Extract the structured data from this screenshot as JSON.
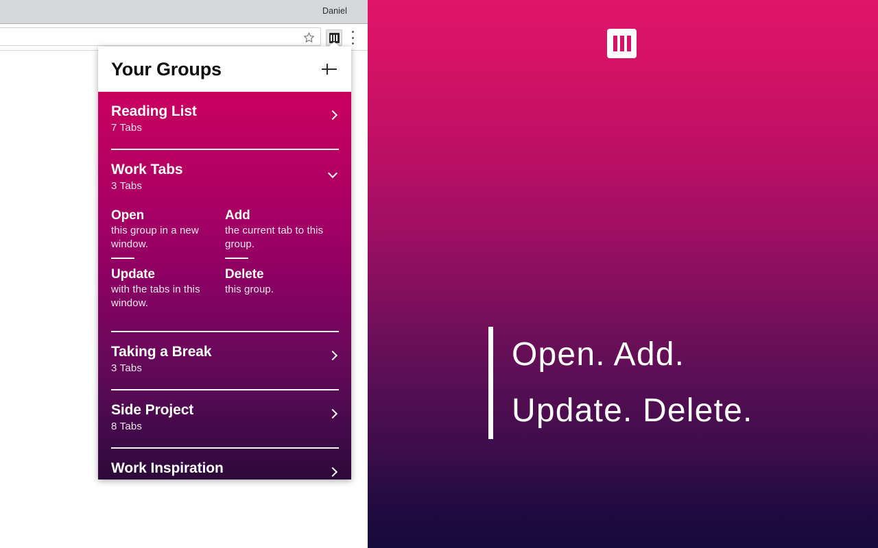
{
  "browser": {
    "profile_name": "Daniel",
    "omnibox_value": "",
    "star_icon": "bookmark-star-icon",
    "extension_icon": "tab-groups-extension-icon",
    "menu_icon": "kebab-menu-icon"
  },
  "popup": {
    "title": "Your Groups",
    "add_button_label": "+",
    "groups": [
      {
        "name": "Reading List",
        "count": "7 Tabs",
        "chevron": "chevron-right-icon",
        "expanded": false
      },
      {
        "name": "Work Tabs",
        "count": "3 Tabs",
        "chevron": "chevron-down-icon",
        "expanded": true,
        "actions": [
          {
            "verb": "Open",
            "desc": "this group in a new window."
          },
          {
            "verb": "Add",
            "desc": "the current tab to this group."
          },
          {
            "verb": "Update",
            "desc": "with the tabs in this window."
          },
          {
            "verb": "Delete",
            "desc": "this group."
          }
        ]
      },
      {
        "name": "Taking a Break",
        "count": "3 Tabs",
        "chevron": "chevron-right-icon",
        "expanded": false
      },
      {
        "name": "Side Project",
        "count": "8 Tabs",
        "chevron": "chevron-right-icon",
        "expanded": false
      },
      {
        "name": "Work Inspiration",
        "count": "",
        "chevron": "chevron-right-icon",
        "expanded": false
      }
    ]
  },
  "promo": {
    "logo_name": "tab-groups-logo",
    "headline_lines": [
      "Open.  Add.",
      "Update.  Delete."
    ]
  },
  "colors": {
    "popup_gradient_top": "#c90060",
    "popup_gradient_bottom": "#2d0939",
    "promo_gradient_top": "#de1568",
    "promo_gradient_bottom": "#160a3c",
    "accent_pink": "#d41267",
    "text_on_dark": "#ffffff",
    "tabstrip_gray": "#d5d7db"
  }
}
